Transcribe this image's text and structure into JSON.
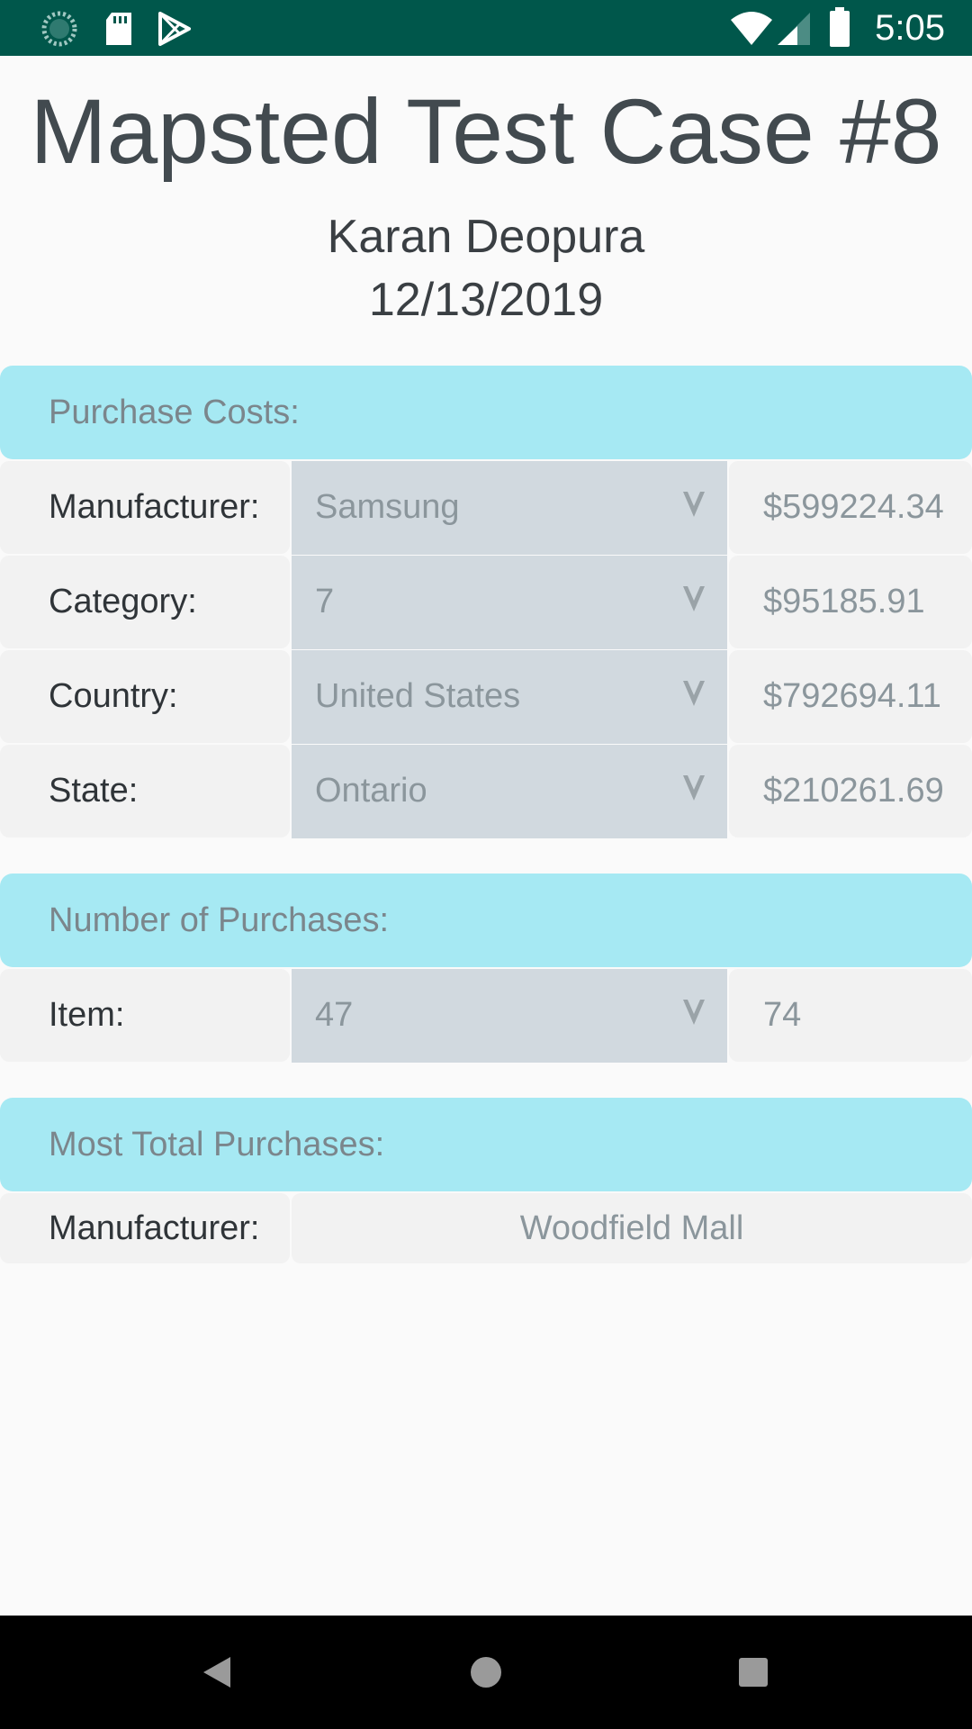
{
  "status_bar": {
    "time": "5:05",
    "left_icons": [
      "sync-icon",
      "sd-card-icon",
      "play-store-icon"
    ],
    "right_icons": [
      "wifi-icon",
      "signal-icon",
      "battery-icon"
    ]
  },
  "header": {
    "title": "Mapsted Test Case #8",
    "author": "Karan Deopura",
    "date": "12/13/2019"
  },
  "purchase_costs": {
    "heading": "Purchase Costs:",
    "rows": [
      {
        "label": "Manufacturer:",
        "selected": "Samsung",
        "value": "$599224.34"
      },
      {
        "label": "Category:",
        "selected": "7",
        "value": "$95185.91"
      },
      {
        "label": "Country:",
        "selected": "United States",
        "value": "$792694.11"
      },
      {
        "label": "State:",
        "selected": "Ontario",
        "value": "$210261.69"
      }
    ]
  },
  "number_of_purchases": {
    "heading": "Number of Purchases:",
    "rows": [
      {
        "label": "Item:",
        "selected": "47",
        "value": "74"
      }
    ]
  },
  "most_total_purchases": {
    "heading": "Most Total Purchases:",
    "label": "Manufacturer:",
    "value": "Woodfield Mall"
  },
  "nav_bar": {
    "buttons": [
      "back-icon",
      "home-icon",
      "recents-icon"
    ]
  },
  "colors": {
    "status_bar": "#00574b",
    "section_header": "#a6e9f3",
    "select_background": "#d1d9df",
    "cell_background": "#f2f2f2"
  }
}
